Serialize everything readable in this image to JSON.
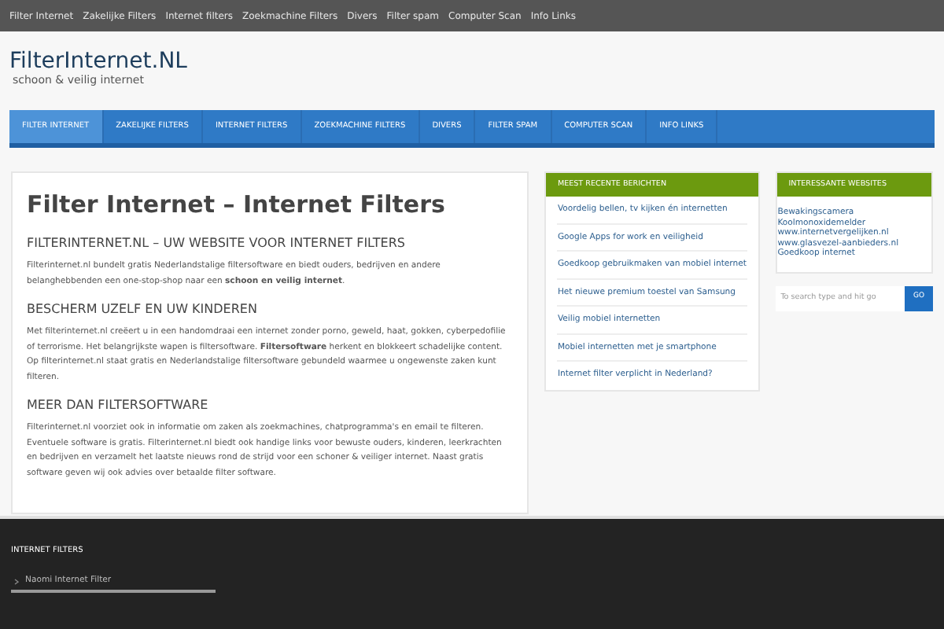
{
  "top_menu": [
    "Filter Internet",
    "Zakelijke Filters",
    "Internet filters",
    "Zoekmachine Filters",
    "Divers",
    "Filter spam",
    "Computer Scan",
    "Info Links"
  ],
  "logo": {
    "title": "FilterInternet.NL",
    "tagline": "schoon & veilig internet"
  },
  "nav": [
    {
      "label": "FILTER INTERNET",
      "selected": true
    },
    {
      "label": "ZAKELIJKE FILTERS",
      "selected": false
    },
    {
      "label": "INTERNET FILTERS",
      "selected": false
    },
    {
      "label": "ZOEKMACHINE FILTERS",
      "selected": false
    },
    {
      "label": "DIVERS",
      "selected": false
    },
    {
      "label": "FILTER SPAM",
      "selected": false
    },
    {
      "label": "COMPUTER SCAN",
      "selected": false
    },
    {
      "label": "INFO LINKS",
      "selected": false
    }
  ],
  "article": {
    "title": "Filter Internet – Internet Filters",
    "sections": [
      {
        "heading": "FILTERINTERNET.NL – UW WEBSITE VOOR INTERNET FILTERS",
        "text": "Filterinternet.nl bundelt gratis Nederlandstalige filtersoftware en biedt ouders, bedrijven en andere belanghebbenden een one-stop-shop naar een **schoon en veilig internet**."
      },
      {
        "heading": "BESCHERM UZELF EN UW KINDEREN",
        "text": "Met filterinternet.nl creëert u in een handomdraai een internet zonder porno, geweld, haat, gokken, cyberpedofilie of terrorisme. Het belangrijkste wapen is filtersoftware. **Filtersoftware** herkent en blokkeert schadelijke content. Op filterinternet.nl staat gratis en Nederlandstalige filtersoftware gebundeld waarmee u ongewenste zaken kunt filteren."
      },
      {
        "heading": "MEER DAN FILTERSOFTWARE",
        "text": "Filterinternet.nl voorziet ook in informatie om zaken als zoekmachines, chatprogramma's en email te filteren. Eventuele software is gratis. Filterinternet.nl biedt ook handige links voor bewuste ouders, kinderen, leerkrachten en bedrijven en verzamelt het laatste nieuws rond de strijd voor een schoner & veiliger internet. Naast gratis software geven wij ook advies over betaalde filter software."
      }
    ]
  },
  "recent_posts": {
    "title": "MEEST RECENTE BERICHTEN",
    "items": [
      "Voordelig bellen, tv kijken én internetten",
      "Google Apps for work en veiligheid",
      "Goedkoop gebruikmaken van mobiel internet",
      "Het nieuwe premium toestel van Samsung",
      "Veilig mobiel internetten",
      "Mobiel internetten met je smartphone",
      "Internet filter verplicht in Nederland?"
    ]
  },
  "websites": {
    "title": "INTERESSANTE WEBSITES",
    "items": [
      "Bewakingscamera",
      "Koolmonoxidemelder",
      "www.internetvergelijken.nl",
      "www.glasvezel-aanbieders.nl",
      "Goedkoop internet"
    ]
  },
  "search": {
    "placeholder": "To search type and hit go",
    "button": "GO"
  },
  "footer": {
    "title": "INTERNET FILTERS",
    "items": [
      "Naomi Internet Filter"
    ]
  }
}
